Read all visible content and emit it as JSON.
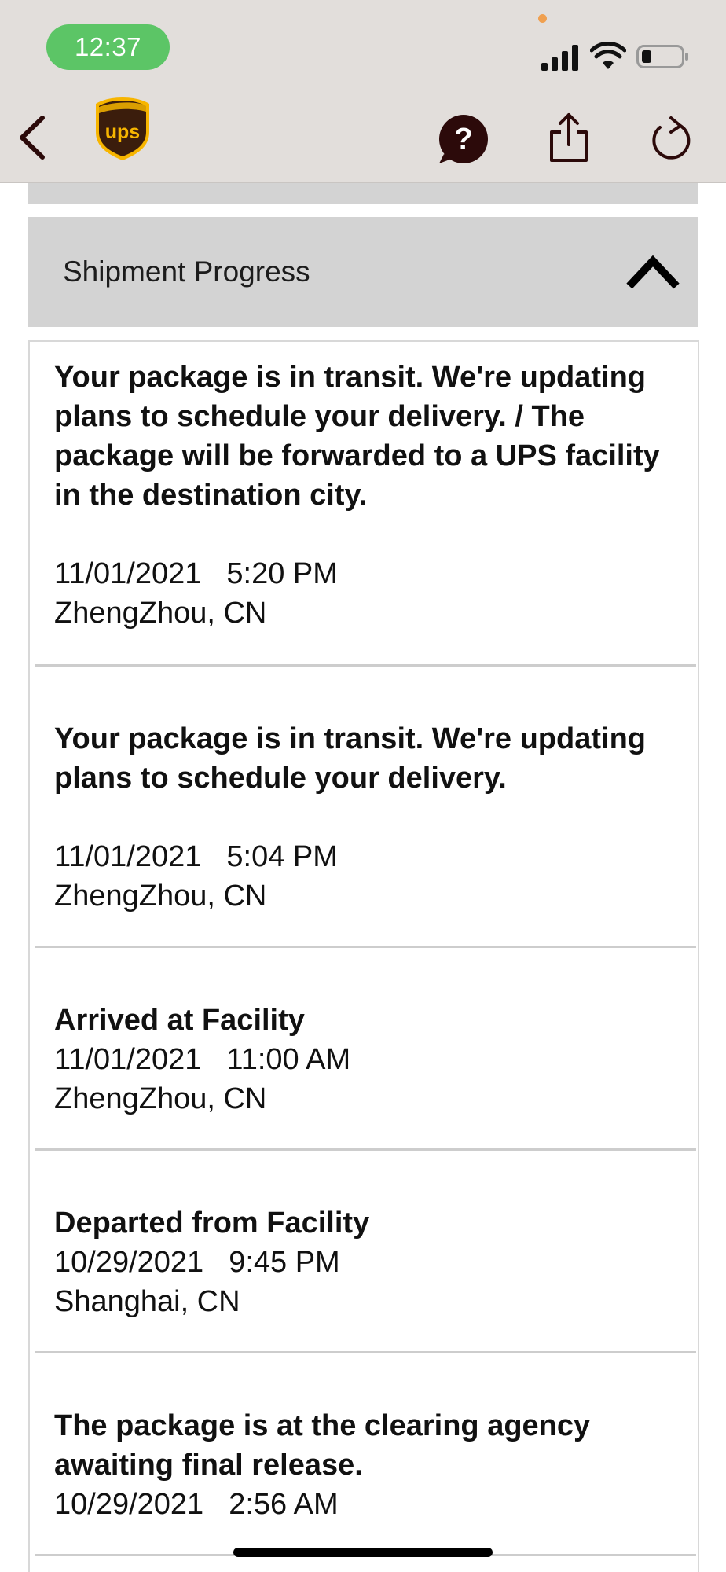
{
  "status_bar": {
    "time": "12:37"
  },
  "header": {
    "back_icon": "chevron-left-icon",
    "logo": "ups-logo",
    "logo_text": "ups",
    "actions": [
      "help-icon",
      "share-icon",
      "refresh-icon"
    ]
  },
  "section": {
    "title": "Shipment Progress",
    "toggle_icon": "chevron-up-icon"
  },
  "events": [
    {
      "description": "Your package is in transit. We're updating plans to schedule your delivery. / The package will be forwarded to a UPS facility in the destination city.",
      "date": "11/01/2021",
      "time": "5:20 PM",
      "location": "ZhengZhou, CN"
    },
    {
      "description": "Your package is in transit. We're updating plans to schedule your delivery.",
      "date": "11/01/2021",
      "time": "5:04 PM",
      "location": "ZhengZhou, CN"
    },
    {
      "description": "Arrived at Facility",
      "date": "11/01/2021",
      "time": "11:00 AM",
      "location": "ZhengZhou, CN"
    },
    {
      "description": "Departed from Facility",
      "date": "10/29/2021",
      "time": "9:45 PM",
      "location": "Shanghai, CN"
    },
    {
      "description": "The package is at the clearing agency awaiting final release.",
      "date": "10/29/2021",
      "time": "2:56 AM"
    }
  ],
  "colors": {
    "header_bg": "#e2dedb",
    "time_pill": "#5cc566",
    "section_bg": "#d3d3d3",
    "ups_brown": "#3b1d0c",
    "ups_gold": "#f7b500",
    "icon_brown": "#2c0a0a"
  }
}
